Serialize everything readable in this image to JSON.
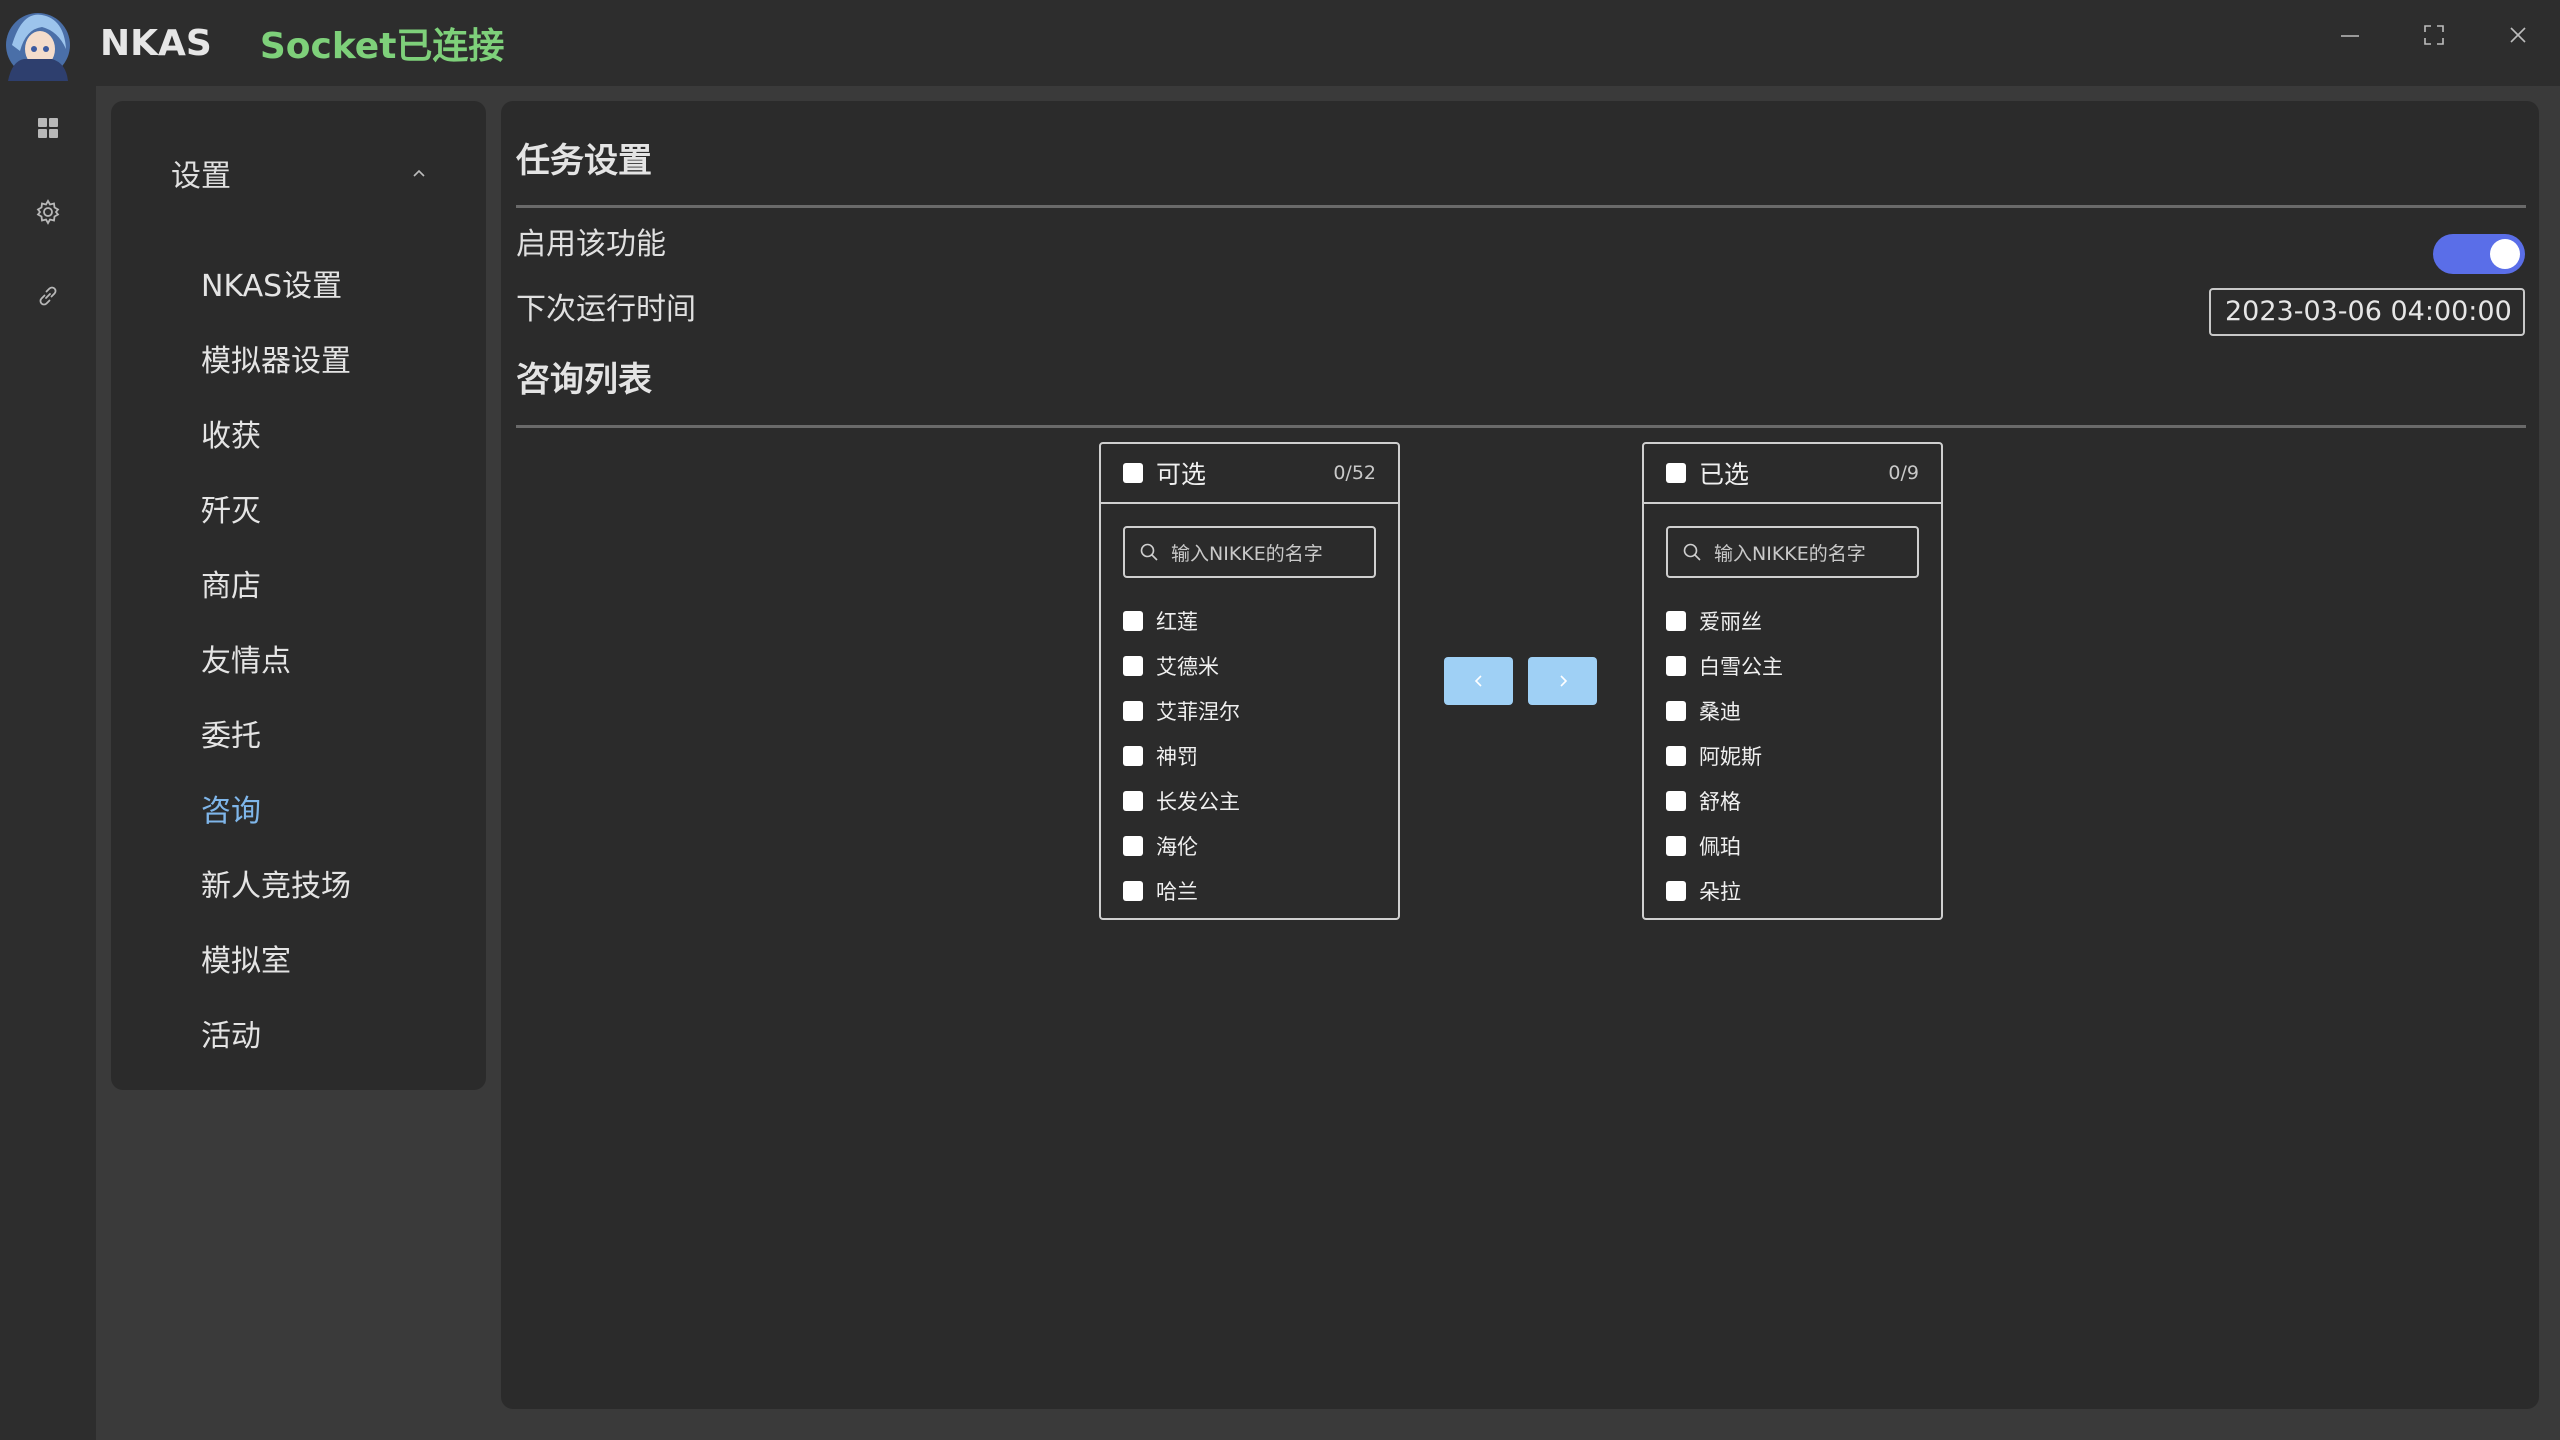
{
  "titlebar": {
    "app_name": "NKAS",
    "socket_status": "Socket已连接",
    "controls": [
      "minimize-icon",
      "maximize-icon",
      "close-icon"
    ]
  },
  "rail": {
    "icons": [
      "grid-icon",
      "gear-icon",
      "link-icon"
    ]
  },
  "nav": {
    "header": "设置",
    "items": [
      {
        "label": "NKAS设置",
        "active": false
      },
      {
        "label": "模拟器设置",
        "active": false
      },
      {
        "label": "收获",
        "active": false
      },
      {
        "label": "歼灭",
        "active": false
      },
      {
        "label": "商店",
        "active": false
      },
      {
        "label": "友情点",
        "active": false
      },
      {
        "label": "委托",
        "active": false
      },
      {
        "label": "咨询",
        "active": true
      },
      {
        "label": "新人竞技场",
        "active": false
      },
      {
        "label": "模拟室",
        "active": false
      },
      {
        "label": "活动",
        "active": false
      }
    ],
    "active_color": "#7fb6ea"
  },
  "main": {
    "task_title": "任务设置",
    "enable_label": "启用该功能",
    "enable_on": true,
    "next_run_label": "下次运行时间",
    "next_run_value": "2023-03-06 04:00:00",
    "list_title": "咨询列表",
    "accent": "#5a6ee8"
  },
  "transfer": {
    "left": {
      "title": "可选",
      "count": "0/52",
      "placeholder": "输入NIKKE的名字",
      "items": [
        "红莲",
        "艾德米",
        "艾菲涅尔",
        "神罚",
        "长发公主",
        "海伦",
        "哈兰"
      ]
    },
    "right": {
      "title": "已选",
      "count": "0/9",
      "placeholder": "输入NIKKE的名字",
      "items": [
        "爱丽丝",
        "白雪公主",
        "桑迪",
        "阿妮斯",
        "舒格",
        "佩珀",
        "朵拉"
      ]
    },
    "button_color": "#9fd0f5"
  }
}
